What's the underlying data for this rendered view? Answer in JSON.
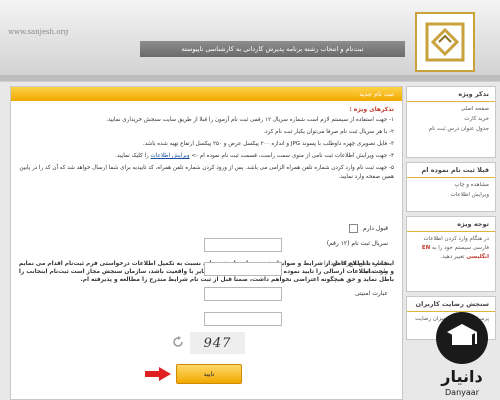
{
  "header": {
    "site_url": "www.sanjesh.org",
    "banner": "ثبت‌نام و انتخاب رشته برنامه پذیرش کاردانی به کارشناسی ناپیوسته"
  },
  "main": {
    "title": "ثبت نام جدید",
    "notes_title": "تذکرهای ویژه :",
    "notes": [
      "۱- جهت استفاده از سیستم لازم است شماره سریال ۱۲ رقمی ثبت نام آزمون را قبلا از طریق سایت سنجش خریداری نمایید.",
      "۲- با هر سریال ثبت نام صرفا می‌توان یکبار ثبت نام کرد.",
      "۳- فایل تصویری چهره داوطلب با پسوند JPG و اندازه ۲۰۰ پیکسل عرض و ۲۵۰ پیکسل ارتفاع تهیه شده باشد.",
      "۴- جهت ویرایش اطلاعات ثبت نامی از منوی سمت راست، قسمت ثبت نام نموده ام ->"
    ],
    "notes_link": "ویرایش اطلاعات",
    "notes_link_suffix": "را کلیک نمایید.",
    "note5": "۵- جهت ثبت نام وارد کردن شماره تلفن همراه الزامی می باشد. پس از ورود کردن شماره تلفن همراه، کد تاییدیه برای شما ارسال خواهد شد که آن کد را در پایین همین صفحه وارد نمایید.",
    "agreement": "اینجانب با اطلاع کامل از شرایط و ضوابط دفترچه راهنمای ثبت نام، نسبت به تکمیل اطلاعات درخواستی فرم ثبت‌نام اقدام می نمایم و صحت اطلاعات ارسالی را تایید نموده و در صورتی که اطلاعات مغایر با واقعیت باشد، سازمان سنجش مجاز است ثبت‌نام اینجانب را باطل نماید و حق هیچگونه اعتراضی نخواهم داشت، ضمناً قبل از ثبت نام شرایط مندرج را مطالعه و پذیرفته ام.",
    "accept_label": "قبول دارم",
    "serial_label": "سریال ثبت نام (۱۲ رقم)",
    "phone_label": "شماره تلفن همراه خود را وارد نمائید",
    "captcha_label": "عبارت امنیتی",
    "captcha_value": "947",
    "submit_label": "تایید"
  },
  "sidebar": {
    "box1": {
      "title": "ندکر ویژه",
      "items": [
        "صفحه اصلی",
        "خرید کارت",
        "جدول عنوان درس ثبت نام"
      ]
    },
    "box2": {
      "title": "قبلا ثبت نام نموده ام",
      "items": [
        "مشاهده و چاپ",
        "ویرایش اطلاعات"
      ]
    },
    "box3": {
      "title": "توجه ویژه",
      "text": "در هنگام وارد کردن اطلاعات فارسی سیستم خود را به",
      "en": "EN انگلیسی",
      "text2": "تغییر دهید."
    },
    "box4": {
      "title": "سنجش رضایت کاربران",
      "text": "پرسشنامه ارزیابی میزان رضایت"
    }
  },
  "watermark": {
    "name": "دانیار",
    "latin": "Danyaar"
  },
  "colors": {
    "accent": "#f0a800",
    "link": "#1a4fa0",
    "highlight": "#c0392b"
  }
}
